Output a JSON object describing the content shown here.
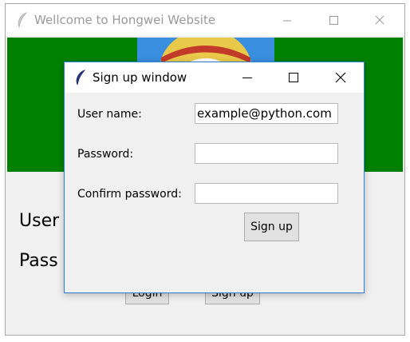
{
  "main_window": {
    "title": "Wellcome to Hongwei Website",
    "labels": {
      "username": "User",
      "password": "Pass"
    },
    "buttons": {
      "login": "Login",
      "signup": "Sign up"
    }
  },
  "signup_dialog": {
    "title": "Sign up window",
    "fields": {
      "username_label": "User name:",
      "username_value": "example@python.com",
      "password_label": "Password:",
      "password_value": "",
      "confirm_label": "Confirm password:",
      "confirm_value": ""
    },
    "signup_button": "Sign up"
  },
  "colors": {
    "banner": "#008000",
    "dialog_border": "#2f7fd1"
  },
  "icons": [
    "feather-icon",
    "minimize-icon",
    "maximize-icon",
    "close-icon"
  ]
}
